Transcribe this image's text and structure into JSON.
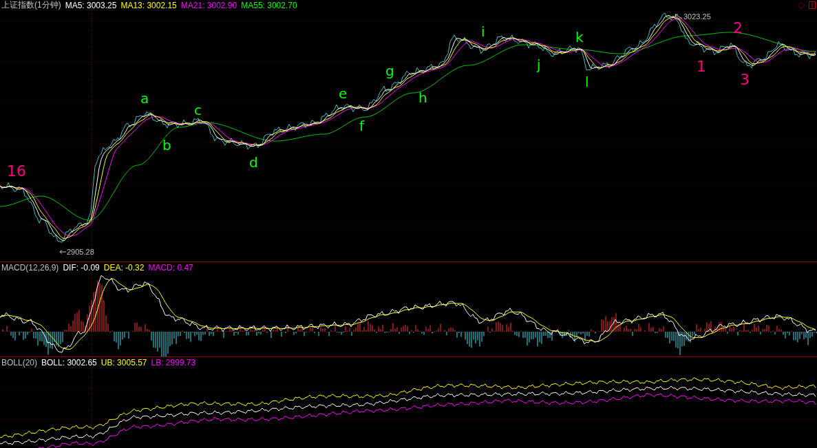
{
  "main_panel": {
    "title": "上证指数(1分钟)",
    "indicators": [
      {
        "label": "MA5: 3003.25",
        "color": "#ffffff"
      },
      {
        "label": "MA13: 3002.15",
        "color": "#ffff00"
      },
      {
        "label": "MA21: 3002.90",
        "color": "#ff00ff"
      },
      {
        "label": "MA55: 3002.70",
        "color": "#00ff00"
      }
    ],
    "high_label": "3023.25",
    "low_label": "2905.28",
    "annotations": [
      {
        "text": "16",
        "color": "#ff0080"
      },
      {
        "text": "a",
        "color": "#00ff00"
      },
      {
        "text": "b",
        "color": "#00ff00"
      },
      {
        "text": "c",
        "color": "#00ff00"
      },
      {
        "text": "d",
        "color": "#00ff00"
      },
      {
        "text": "e",
        "color": "#00ff00"
      },
      {
        "text": "f",
        "color": "#00ff00"
      },
      {
        "text": "g",
        "color": "#00ff00"
      },
      {
        "text": "h",
        "color": "#00ff00"
      },
      {
        "text": "i",
        "color": "#00ff00"
      },
      {
        "text": "j",
        "color": "#00ff00"
      },
      {
        "text": "k",
        "color": "#00ff00"
      },
      {
        "text": "l",
        "color": "#00ff00"
      },
      {
        "text": "1",
        "color": "#ff0080"
      },
      {
        "text": "2",
        "color": "#ff0080"
      },
      {
        "text": "3",
        "color": "#ff0080"
      }
    ]
  },
  "macd_panel": {
    "title": "MACD(12,26,9)",
    "indicators": [
      {
        "label": "DIF: -0.09",
        "color": "#ffffff"
      },
      {
        "label": "DEA: -0.32",
        "color": "#ffff00"
      },
      {
        "label": "MACD: 0.47",
        "color": "#ff00ff"
      }
    ]
  },
  "boll_panel": {
    "title": "BOLL(20)",
    "indicators": [
      {
        "label": "BOLL: 3002.65",
        "color": "#ffffff"
      },
      {
        "label": "UB: 3005.57",
        "color": "#ffff00"
      },
      {
        "label": "LB: 2999.73",
        "color": "#ff00ff"
      }
    ]
  }
}
